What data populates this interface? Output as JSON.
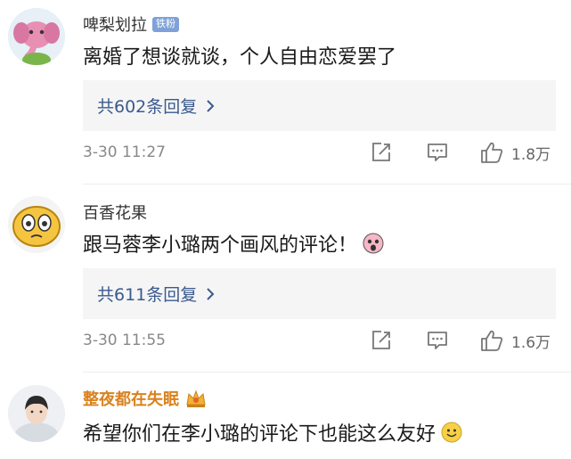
{
  "comments": [
    {
      "username": "啤梨划拉",
      "badge": "铁粉",
      "text": "离婚了想谈就谈，个人自由恋爱罢了",
      "reply_label": "共602条回复",
      "time": "3-30 11:27",
      "likes": "1.8万",
      "avatar_icon": "pink-elephant-avatar"
    },
    {
      "username": "百香花果",
      "text": "跟马蓉李小璐两个画风的评论！",
      "emoji_icon": "surprised-face-emoji",
      "reply_label": "共611条回复",
      "time": "3-30 11:55",
      "likes": "1.6万",
      "avatar_icon": "yellow-face-avatar"
    },
    {
      "username": "整夜都在失眠",
      "username_color": "#d9821e",
      "text": "希望你们在李小璐的评论下也能这么友好",
      "emoji_icon": "smiling-face-emoji",
      "avatar_icon": "person-photo-avatar"
    }
  ],
  "icons": {
    "share": "share-icon",
    "comment": "comment-icon",
    "like": "thumbs-up-icon",
    "chevron": "chevron-right-icon"
  },
  "colors": {
    "link": "#3a5a8f",
    "badge": "#7fa1d8",
    "meta": "#888888",
    "reply_bg": "#f5f5f5"
  }
}
